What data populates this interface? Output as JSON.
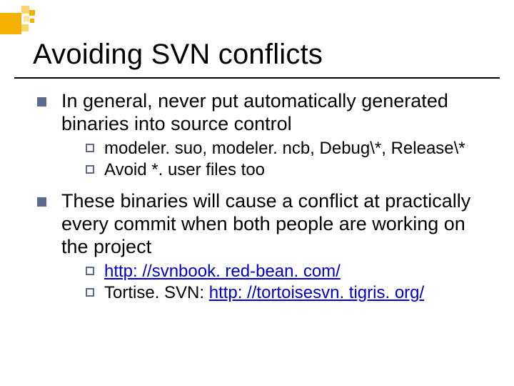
{
  "title": "Avoiding SVN conflicts",
  "bullets": {
    "b1": "In general, never put automatically generated binaries into source control",
    "b1_sub1_a": "modeler. suo,",
    "b1_sub1_b": " modeler. ncb, Debug\\*, Release\\*",
    "b1_sub2_a": "Avoid",
    "b1_sub2_b": " *. user files too",
    "b2": "These binaries will cause a conflict at practically every commit when both people are working on the project",
    "b2_sub1": "http: //svnbook. red-bean. com/",
    "b2_sub2_a": "Tortise. SVN:",
    "b2_sub2_b": "http: //tortoisesvn. tigris. org/"
  }
}
